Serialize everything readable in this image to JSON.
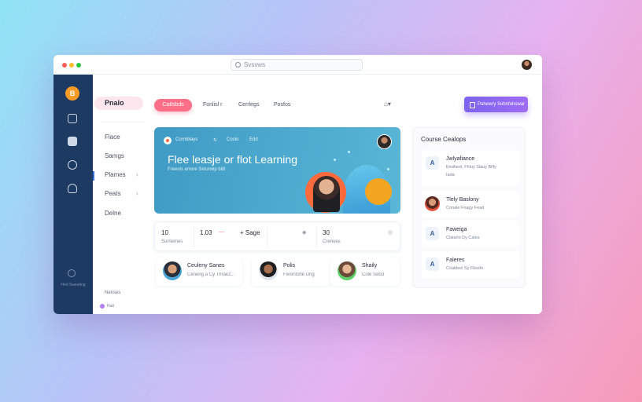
{
  "search": {
    "placeholder": "Svsvws"
  },
  "rail": {
    "logo": "B",
    "bottom_label": "Hed Sweeting"
  },
  "nav": {
    "title": "Pnalo",
    "items": [
      {
        "label": "Flace",
        "chevron": ""
      },
      {
        "label": "Samgs",
        "chevron": ""
      },
      {
        "label": "Plames",
        "chevron": "›"
      },
      {
        "label": "Peats",
        "chevron": "›"
      },
      {
        "label": "Delne",
        "chevron": ""
      }
    ],
    "footer_title": "Nenses",
    "footer_item": "Huit"
  },
  "tabs": [
    {
      "label": "Catlsbds"
    },
    {
      "label": "Fonlisl r"
    },
    {
      "label": "Cerrlegs"
    },
    {
      "label": "Posfos"
    }
  ],
  "filter": {
    "label": "⌂▾"
  },
  "cta": {
    "label": "Pahewry Sohnfohswar"
  },
  "hero": {
    "crumbs": [
      "Corniblays",
      "↻",
      "Coslo",
      "Edd"
    ],
    "title": "Flee leasje or flot Learning",
    "subtitle": "Freests errere Seturwip biitl"
  },
  "stats": [
    {
      "value": "10",
      "label": "Surriemes"
    },
    {
      "value": "1.03",
      "label": ""
    },
    {
      "value": "+ Sage",
      "label": ""
    },
    {
      "value": "30",
      "label": "Crenues"
    }
  ],
  "stat_icons": {
    "trend": "—",
    "gem": "◆",
    "gauge": "◎"
  },
  "people": [
    {
      "name": "Ceuleny Sanes",
      "role": "Cenerig a Cy Thraez..."
    },
    {
      "name": "Polis",
      "role": "Ferentshe Ung"
    },
    {
      "name": "Shaily",
      "role": "Cole Sdod"
    }
  ],
  "panel": {
    "title": "Course Cealops",
    "items": [
      {
        "icon": "A",
        "name": "Jwlyafiance",
        "sub": "Eedhenl, Fhluy Slauy Bilfy",
        "sub2": "Iada"
      },
      {
        "icon": "",
        "name": "Tlely Baslony",
        "sub": "Conale Fnagy Fead",
        "sub2": ""
      },
      {
        "icon": "A",
        "name": "Faweiga",
        "sub": "Clalarlo Dy Calos",
        "sub2": ""
      },
      {
        "icon": "A",
        "name": "Faleres",
        "sub": "Coaldecl Sy Fbssfo",
        "sub2": ""
      }
    ]
  },
  "colors": {
    "rail": "#1d3a63",
    "accent_pink": "#ff6f88",
    "accent_purple": "#7b64f0",
    "hero": "#3f9bc4",
    "logo": "#f59a24"
  }
}
